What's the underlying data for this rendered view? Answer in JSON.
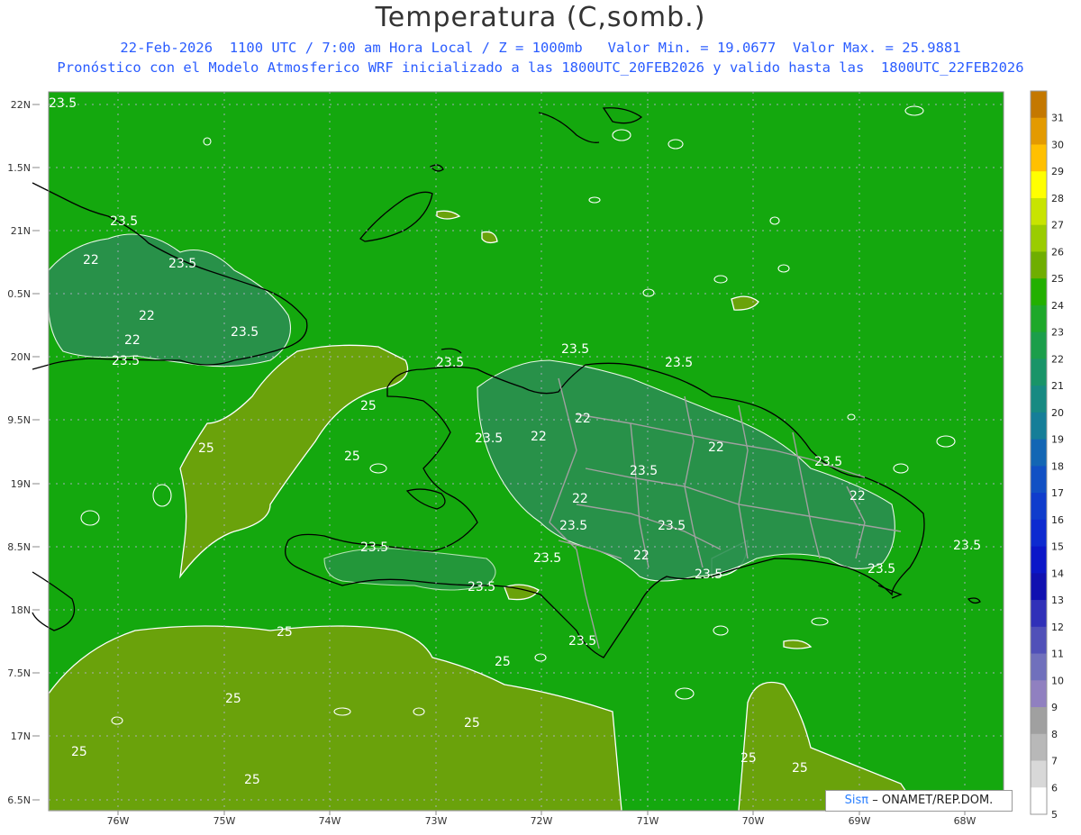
{
  "title": "Temperatura (C,somb.)",
  "subtitle_line1": "22-Feb-2026  1100 UTC / 7:00 am Hora Local / Z = 1000mb   Valor Min. = 19.0677  Valor Max. = 25.9881",
  "subtitle_line2": "Pronóstico con el Modelo Atmosferico WRF inicializado a las 1800UTC_20FEB2026 y valido hasta las  1800UTC_22FEB2026",
  "lat_labels": [
    "22N",
    "1.5N",
    "21N",
    "0.5N",
    "20N",
    "9.5N",
    "19N",
    "8.5N",
    "18N",
    "7.5N",
    "17N",
    "6.5N"
  ],
  "lon_labels": [
    "76W",
    "75W",
    "74W",
    "73W",
    "72W",
    "71W",
    "70W",
    "69W",
    "68W"
  ],
  "colorbar": {
    "labels": [
      "31",
      "30",
      "29",
      "28",
      "27",
      "26",
      "25",
      "24",
      "23",
      "22",
      "21",
      "20",
      "19",
      "18",
      "17",
      "16",
      "15",
      "14",
      "13",
      "12",
      "11",
      "10",
      "9",
      "8",
      "7",
      "6",
      "5"
    ],
    "colors": [
      "#c47800",
      "#e39a00",
      "#ffc000",
      "#ffff00",
      "#c8e400",
      "#9acc00",
      "#6fae00",
      "#22b000",
      "#1ea82a",
      "#1b9e4a",
      "#199468",
      "#178a82",
      "#157e98",
      "#1366b4",
      "#1150c4",
      "#0f3ccc",
      "#0d2ad0",
      "#0b16c8",
      "#1010b0",
      "#3030b8",
      "#5050b8",
      "#7070bc",
      "#9080c0",
      "#a0a0a0",
      "#b8b8b8",
      "#d8d8d8",
      "#ffffff"
    ]
  },
  "contour_labels": {
    "c235": "23.5",
    "c22": "22",
    "c25": "25"
  },
  "credit": {
    "sis": "Sisπ",
    "org": "– ONAMET/REP.DOM."
  },
  "colors": {
    "sea_green": "#14a80e",
    "warm_olive": "#6aa20b",
    "cool_teal": "#2b8f50",
    "coast": "#000000",
    "provinces": "#a0a0a0",
    "contour": "#ffffff"
  }
}
